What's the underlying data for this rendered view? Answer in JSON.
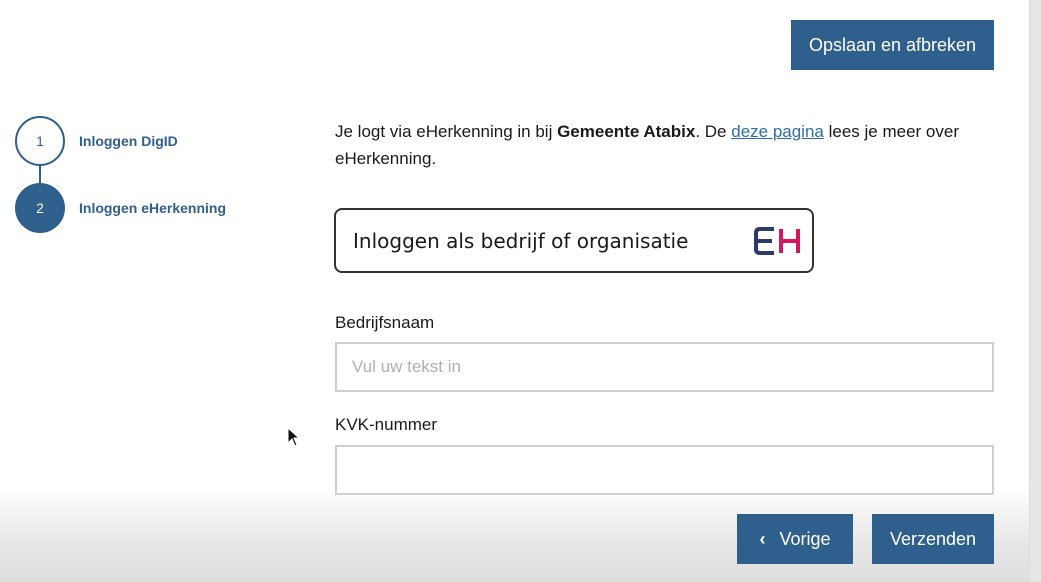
{
  "header": {
    "save_button_label": "Opslaan en afbreken"
  },
  "stepper": {
    "steps": [
      {
        "number": "1",
        "label": "Inloggen DigID",
        "state": "completed"
      },
      {
        "number": "2",
        "label": "Inloggen eHerkenning",
        "state": "active"
      }
    ]
  },
  "intro": {
    "part1": "Je logt via eHerkenning in bij ",
    "organisation": "Gemeente Atabix",
    "part2": ". De ",
    "link_text": "deze pagina",
    "part3": " lees je meer over eHerkenning."
  },
  "eherkenning": {
    "button_label": "Inloggen als bedrijf of organisatie",
    "logo_icon": "eherkenning-logo-icon",
    "logo_color_dark": "#2b3a6b",
    "logo_color_accent": "#d6175f"
  },
  "form": {
    "company_name": {
      "label": "Bedrijfsnaam",
      "placeholder": "Vul uw tekst in",
      "value": ""
    },
    "kvk_number": {
      "label": "KVK-nummer",
      "placeholder": "",
      "value": ""
    }
  },
  "footer": {
    "prev_label": "Vorige",
    "prev_icon": "chevron-left-icon",
    "submit_label": "Verzenden"
  },
  "colors": {
    "primary": "#2f5f8c",
    "link": "#2f6fa8"
  }
}
